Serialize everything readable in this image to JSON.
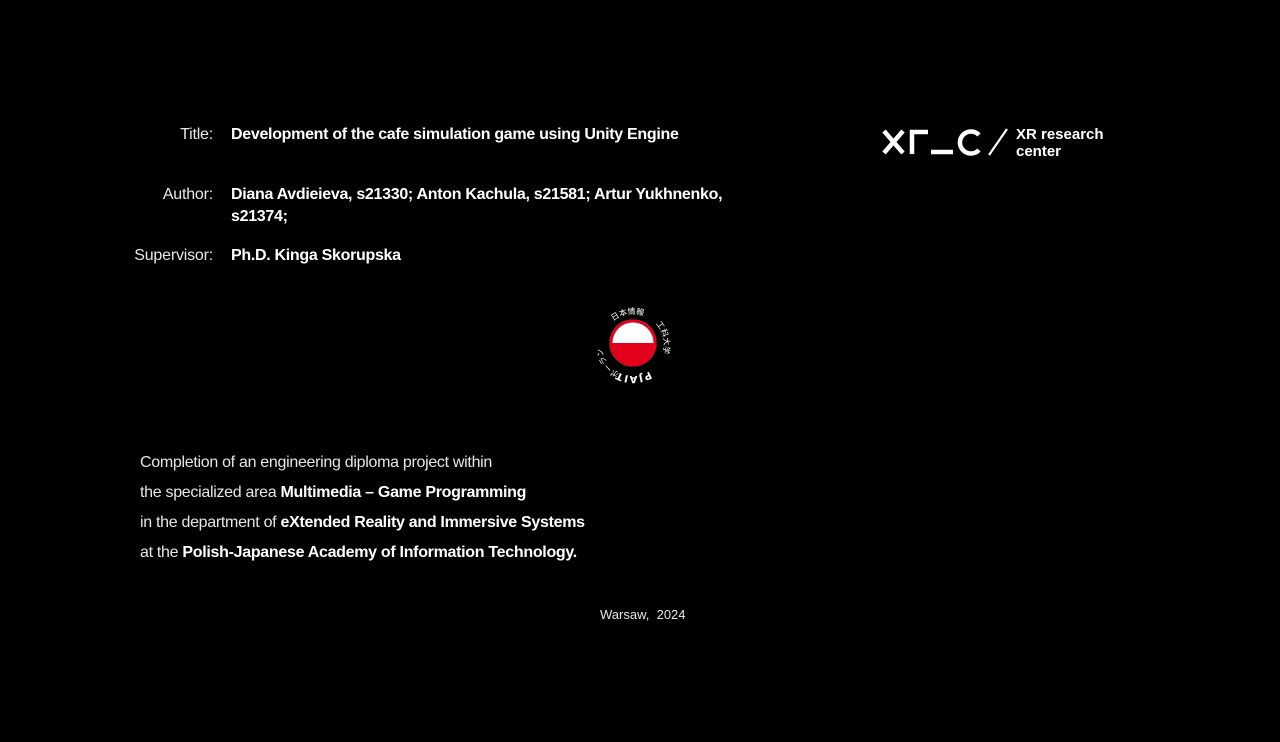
{
  "colors": {
    "background": "#000000",
    "text": "#ffffff",
    "seal_red": "#e3001b"
  },
  "meta": {
    "title_label": "Title:",
    "title_value": "Development of the cafe simulation game using Unity Engine",
    "author_label": "Author:",
    "author_value": "Diana Avdieieva, s21330; Anton Kachula, s21581; Artur Yukhnenko, s21374;",
    "supervisor_label": "Supervisor:",
    "supervisor_value": "Ph.D. Kinga Skorupska"
  },
  "logo": {
    "mark": "XR_C",
    "line1": "XR research",
    "line2": "center",
    "icon": "xr-research-center-logo"
  },
  "seal": {
    "icon": "pjait-seal-icon",
    "top_text": "PJAIT",
    "right_text": "ポーランド",
    "bottom_text": "日本情報",
    "left_text": "工科大学"
  },
  "description": {
    "line1": "Completion of an engineering diploma project within",
    "line2_prefix": "the specialized area ",
    "line2_bold": "Multimedia – Game Programming",
    "line3_prefix": "in the department of ",
    "line3_bold": "eXtended Reality and Immersive Systems",
    "line4_prefix": "at the ",
    "line4_bold": "Polish-Japanese Academy of Information Technology."
  },
  "footer": {
    "city": "Warsaw,",
    "year": "2024"
  }
}
